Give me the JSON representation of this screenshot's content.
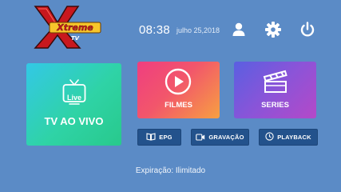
{
  "header": {
    "logo_text": "Xtreme",
    "logo_subtext": "TV",
    "time": "08:38",
    "date": "julho 25,2018",
    "icons": [
      "user-icon",
      "gear-icon",
      "power-icon"
    ]
  },
  "tiles": {
    "live": {
      "badge": "Live",
      "label": "TV AO VIVO"
    },
    "films": {
      "label": "FILMES"
    },
    "series": {
      "label": "SERIES"
    }
  },
  "buttons": {
    "epg": "EPG",
    "recording": "GRAVAÇÃO",
    "playback": "PLAYBACK"
  },
  "footer": {
    "expiry": "Expiração: Ilimitado"
  },
  "colors": {
    "background": "#5b8bc6",
    "button": "#23528c"
  }
}
